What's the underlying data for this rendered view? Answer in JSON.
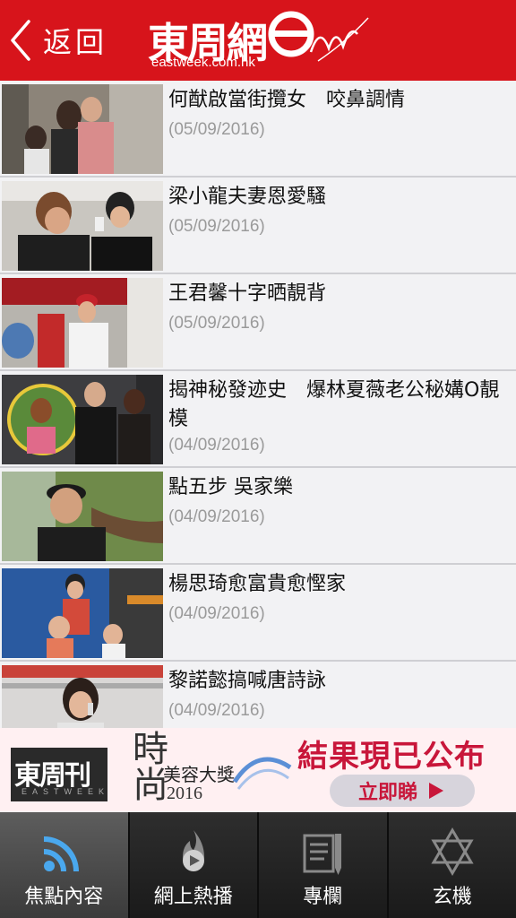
{
  "header": {
    "back_label": "返回",
    "logo_text": "東周網",
    "logo_url": "eastweek.com.hk",
    "brand_color": "#d7141b"
  },
  "articles": [
    {
      "title": "何猷啟當街攬女　咬鼻調情",
      "date": "(05/09/2016)"
    },
    {
      "title": "梁小龍夫妻恩愛騷",
      "date": "(05/09/2016)"
    },
    {
      "title": "王君馨十字晒靚背",
      "date": "(05/09/2016)"
    },
    {
      "title": "揭神秘發迹史　爆林夏薇老公秘媾O靚模",
      "date": "(04/09/2016)"
    },
    {
      "title": "點五步 吳家樂",
      "date": "(04/09/2016)"
    },
    {
      "title": "楊思琦愈富貴愈慳家",
      "date": "(04/09/2016)"
    },
    {
      "title": "黎諾懿搞喊唐詩詠",
      "date": "(04/09/2016)"
    }
  ],
  "banner": {
    "magazine": "東周刊",
    "magazine_en": "EASTWEEK",
    "vertical_text": "時尚",
    "award": "美容大獎",
    "year": "2016",
    "headline": "結果現已公布",
    "cta": "立即睇"
  },
  "tabs": [
    {
      "label": "焦點內容",
      "icon": "rss-icon",
      "active": true
    },
    {
      "label": "網上熱播",
      "icon": "flame-play-icon",
      "active": false
    },
    {
      "label": "專欄",
      "icon": "notebook-pen-icon",
      "active": false
    },
    {
      "label": "玄機",
      "icon": "star-of-david-icon",
      "active": false
    }
  ]
}
